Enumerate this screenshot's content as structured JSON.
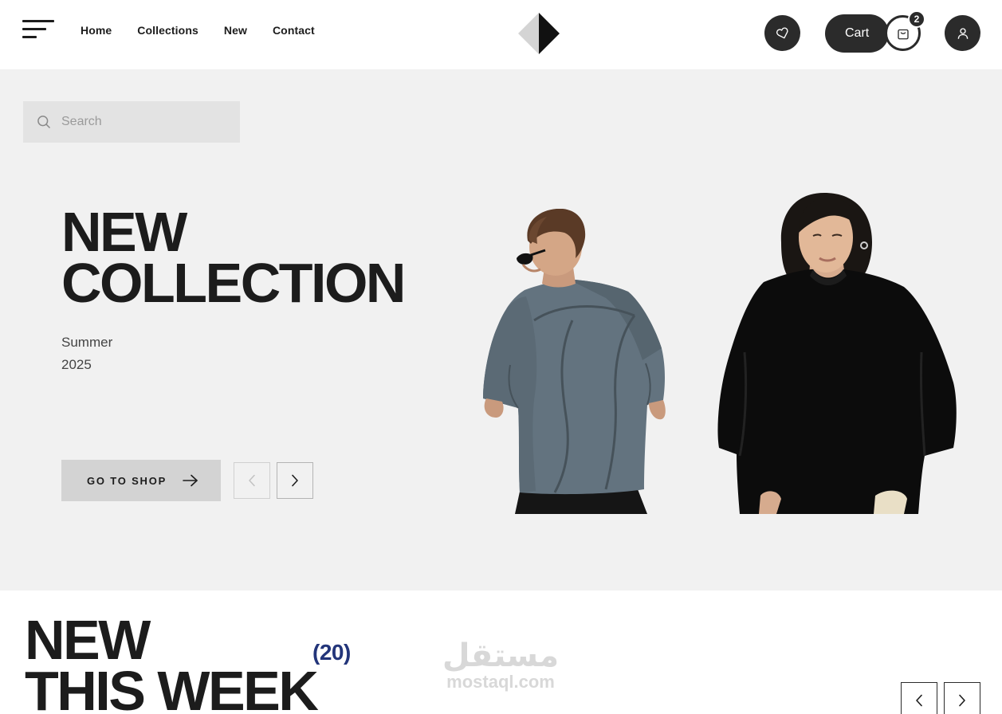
{
  "header": {
    "nav": [
      "Home",
      "Collections",
      "New",
      "Contact"
    ],
    "cart_label": "Cart",
    "cart_count": "2"
  },
  "hero": {
    "search_placeholder": "Search",
    "title_line1": "NEW",
    "title_line2": "COLLECTION",
    "season_line1": "Summer",
    "season_line2": "2025",
    "cta_label": "GO TO SHOP"
  },
  "section": {
    "title_line1": "NEW",
    "title_line2": "THIS WEEK",
    "count": "(20)"
  },
  "watermark": {
    "arabic": "مستقل",
    "latin": "mostaql.com"
  },
  "icons": {
    "menu": "hamburger-icon",
    "logo": "diamond-logo",
    "wishlist": "heart-icon",
    "cart": "shopping-bag-icon",
    "user": "user-icon",
    "search": "search-icon",
    "arrow": "arrow-right-icon",
    "prev": "chevron-left-icon",
    "next": "chevron-right-icon"
  },
  "colors": {
    "dark": "#2b2b2b",
    "hero_bg": "#f1f1f1",
    "accent_count": "#23357a"
  }
}
